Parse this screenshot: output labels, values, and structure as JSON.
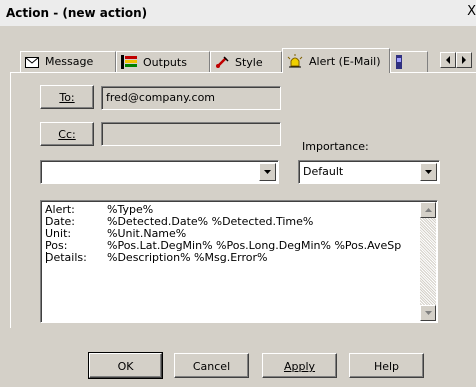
{
  "window": {
    "title": "Action - (new action)",
    "close_glyph": "X"
  },
  "tabs": [
    {
      "label": "Message",
      "icon": "envelope-icon"
    },
    {
      "label": "Outputs",
      "icon": "outputs-icon"
    },
    {
      "label": "Style",
      "icon": "style-icon"
    },
    {
      "label": "Alert (E-Mail)",
      "icon": "alarm-icon",
      "active": true
    }
  ],
  "recipients": {
    "to_label": "To:",
    "to_value": "fred@company.com",
    "cc_label": "Cc:",
    "cc_value": ""
  },
  "account_select": {
    "value": ""
  },
  "importance": {
    "label": "Importance:",
    "value": "Default"
  },
  "message_body": [
    {
      "key": "Alert:",
      "value": "%Type%"
    },
    {
      "key": "Date:",
      "value": "%Detected.Date% %Detected.Time%"
    },
    {
      "key": "Unit:",
      "value": "%Unit.Name%"
    },
    {
      "key": "Pos:",
      "value": "%Pos.Lat.DegMin% %Pos.Long.DegMin% %Pos.AveSp"
    },
    {
      "key": "Details:",
      "value": "%Description% %Msg.Error%"
    }
  ],
  "footer": {
    "ok_label": "OK",
    "cancel_label": "Cancel",
    "apply_label": "Apply",
    "help_label": "Help"
  },
  "colors": {
    "face": "#d4d0c8",
    "shadow": "#808080",
    "highlight": "#ffffff"
  }
}
